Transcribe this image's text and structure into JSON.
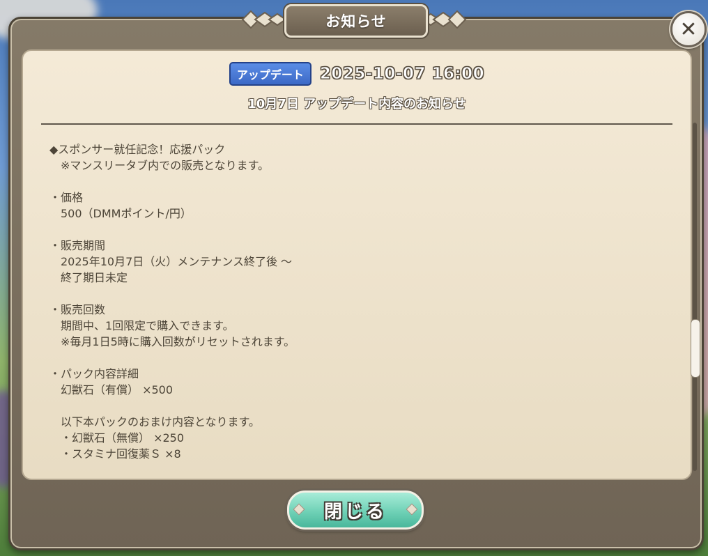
{
  "window": {
    "title": "お知らせ",
    "close_icon": "close-icon"
  },
  "notice": {
    "badge": "アップデート",
    "datetime": "2025-10-07 16:00",
    "subtitle": "10月7日 アップデート内容のお知らせ"
  },
  "content": {
    "lines": [
      "◆スポンサー就任記念！応援パック",
      "　※マンスリータブ内での販売となります。",
      "",
      "・価格",
      "　500（DMMポイント/円）",
      "",
      "・販売期間",
      "　2025年10月7日（火）メンテナンス終了後 ～",
      "　終了期日未定",
      "",
      "・販売回数",
      "　期間中、1回限定で購入できます。",
      "　※毎月1日5時に購入回数がリセットされます。",
      "",
      "・パック内容詳細",
      "　幻獣石（有償） ×500",
      "",
      "　以下本パックのおまけ内容となります。",
      "　・幻獣石（無償） ×250",
      "　・スタミナ回復薬Ｓ ×8"
    ]
  },
  "buttons": {
    "close_label": "閉じる"
  },
  "colors": {
    "frame": "#7a6f5e",
    "panel": "#efe4cd",
    "badge": "#4a7bd8",
    "close_button": "#6fd1b6",
    "text": "#4d4538"
  }
}
